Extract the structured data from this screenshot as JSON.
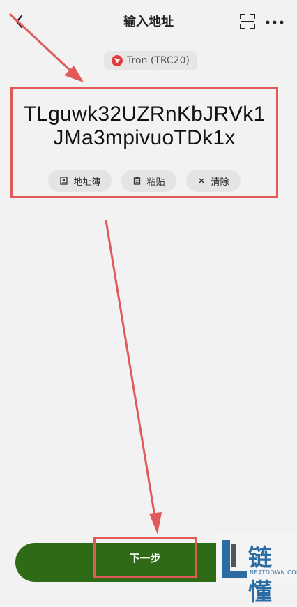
{
  "header": {
    "title": "输入地址"
  },
  "network": {
    "label": "Tron (TRC20)"
  },
  "address": {
    "value": "TLguwk32UZRnKbJRVk1JMa3mpivuoTDk1x"
  },
  "actions": [
    {
      "label": "地址簿",
      "icon": "address-book-icon"
    },
    {
      "label": "粘贴",
      "icon": "clipboard-icon"
    },
    {
      "label": "清除",
      "icon": "close-icon"
    }
  ],
  "next_button": {
    "label": "下一步"
  },
  "logo": {
    "text": "链懂",
    "sub": "NEATDOWN.COM"
  },
  "colors": {
    "primary": "#2f6b17",
    "annotation": "#e05a5a",
    "tron": "#e63a3a",
    "logo": "#2b6ca3"
  }
}
